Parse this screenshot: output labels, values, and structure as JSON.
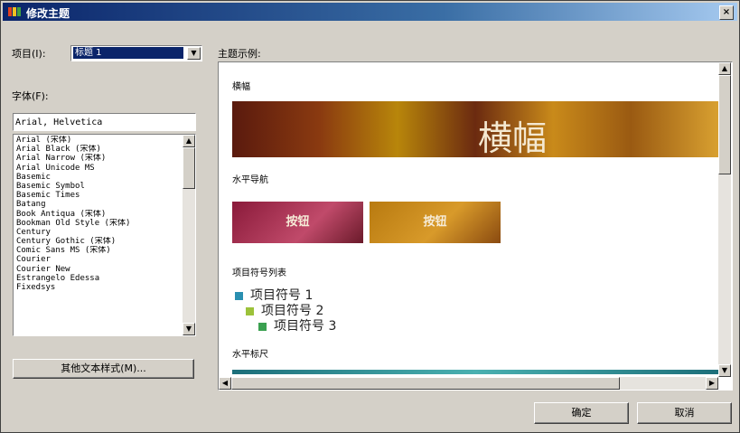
{
  "window": {
    "title": "修改主题",
    "close_glyph": "×"
  },
  "left": {
    "item_label": "项目(I):",
    "item_value": "标题 1",
    "font_label": "字体(F):",
    "font_input": "Arial, Helvetica",
    "fonts": [
      "Arial (宋体)",
      "Arial Black (宋体)",
      "Arial Narrow (宋体)",
      "Arial Unicode MS",
      "Basemic",
      "Basemic Symbol",
      "Basemic Times",
      "Batang",
      "Book Antiqua (宋体)",
      "Bookman Old Style (宋体)",
      "Century",
      "Century Gothic (宋体)",
      "Comic Sans MS (宋体)",
      "Courier",
      "Courier New",
      "Estrangelo Edessa",
      "Fixedsys"
    ],
    "more_styles_button": "其他文本样式(M)..."
  },
  "preview": {
    "label": "主题示例:",
    "banner_label": "横幅",
    "banner_text": "横幅",
    "nav_label": "水平导航",
    "nav_buttons": [
      "按钮",
      "按钮"
    ],
    "bullets_label": "项目符号列表",
    "bullets": [
      "项目符号 1",
      "项目符号 2",
      "项目符号 3"
    ],
    "rule_label": "水平标尺"
  },
  "buttons": {
    "ok": "确定",
    "cancel": "取消"
  },
  "colors": {
    "title_bar": "#0a246a",
    "selection": "#0a246a",
    "bullet_1": "#2a8fb0",
    "bullet_2": "#9cc23a",
    "bullet_3": "#3aa050"
  },
  "icons": {
    "dropdown": "chevron-down-icon",
    "scroll_up": "arrow-up-icon",
    "scroll_down": "arrow-down-icon",
    "scroll_left": "arrow-left-icon",
    "scroll_right": "arrow-right-icon",
    "close": "close-icon"
  }
}
